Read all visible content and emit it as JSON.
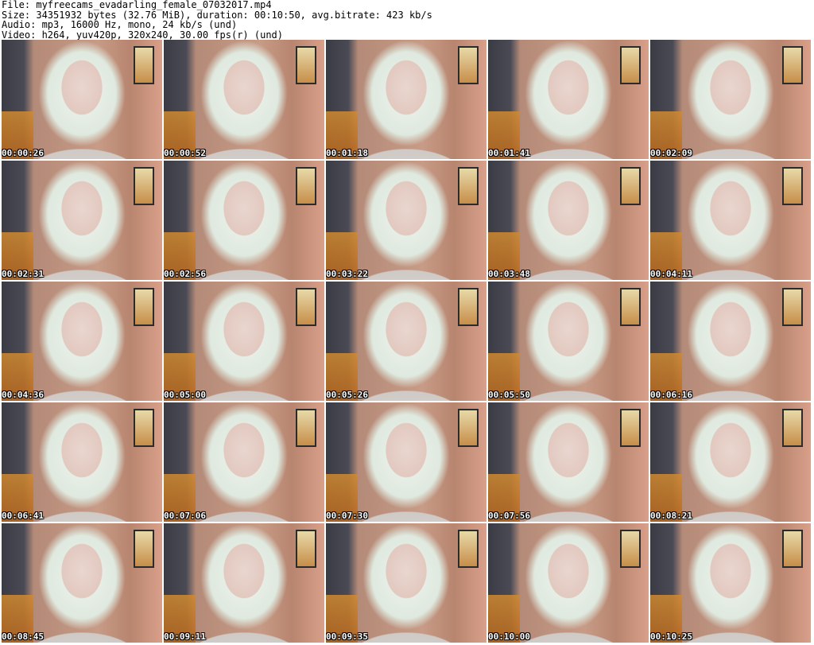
{
  "header": {
    "file": "File: myfreecams_evadarling_female_07032017.mp4",
    "size": "Size: 34351932 bytes (32.76 MiB), duration: 00:10:50, avg.bitrate: 423 kb/s",
    "audio": "Audio: mp3, 16000 Hz, mono, 24 kb/s (und)",
    "video": "Video: h264, yuv420p, 320x240, 30.00 fps(r) (und)"
  },
  "thumbnails": [
    {
      "time": "00:00:26"
    },
    {
      "time": "00:00:52"
    },
    {
      "time": "00:01:18"
    },
    {
      "time": "00:01:41"
    },
    {
      "time": "00:02:09"
    },
    {
      "time": "00:02:31"
    },
    {
      "time": "00:02:56"
    },
    {
      "time": "00:03:22"
    },
    {
      "time": "00:03:48"
    },
    {
      "time": "00:04:11"
    },
    {
      "time": "00:04:36"
    },
    {
      "time": "00:05:00"
    },
    {
      "time": "00:05:26"
    },
    {
      "time": "00:05:50"
    },
    {
      "time": "00:06:16"
    },
    {
      "time": "00:06:41"
    },
    {
      "time": "00:07:06"
    },
    {
      "time": "00:07:30"
    },
    {
      "time": "00:07:56"
    },
    {
      "time": "00:08:21"
    },
    {
      "time": "00:08:45"
    },
    {
      "time": "00:09:11"
    },
    {
      "time": "00:09:35"
    },
    {
      "time": "00:10:00"
    },
    {
      "time": "00:10:25"
    }
  ]
}
